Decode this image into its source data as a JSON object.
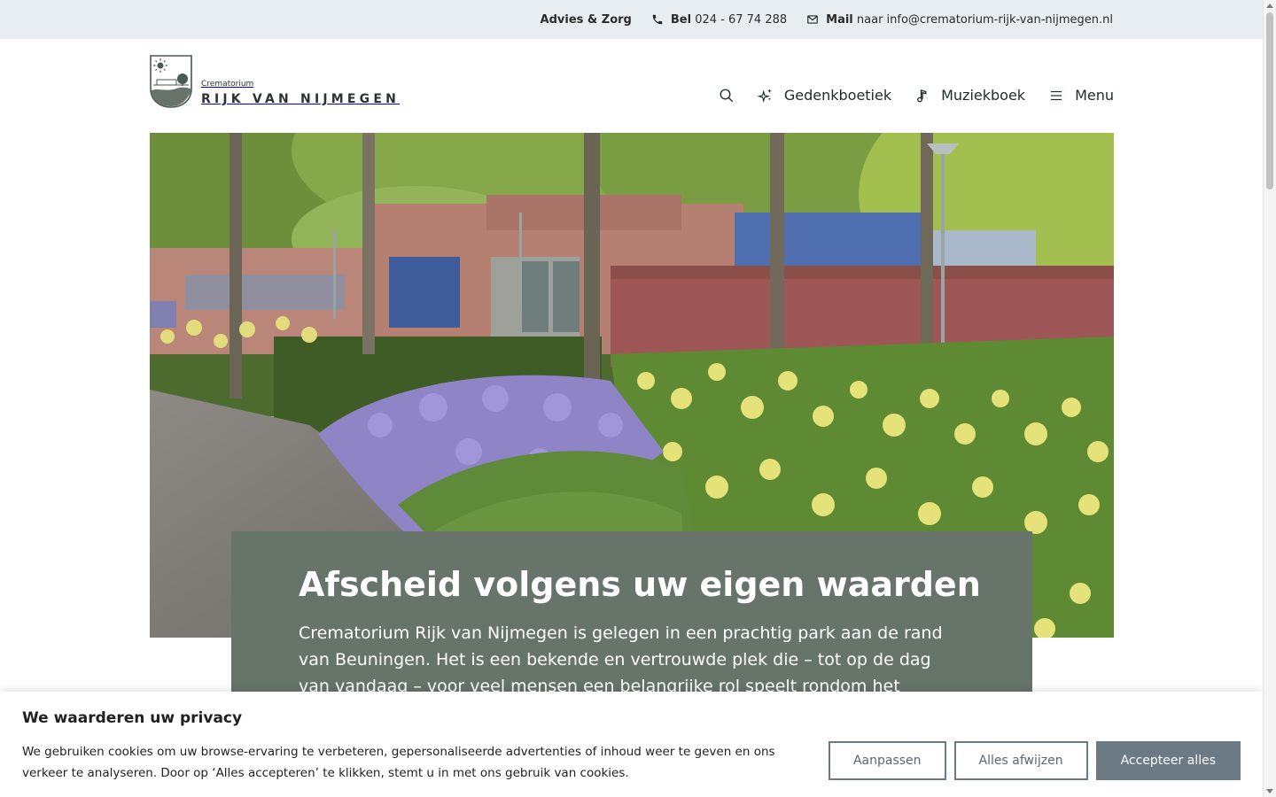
{
  "topbar": {
    "advice_label": "Advies & Zorg",
    "phone_label": "Bel",
    "phone_number": "024 - 67 74 288",
    "mail_label": "Mail",
    "mail_text": "naar info@crematorium-rijk-van-nijmegen.nl"
  },
  "logo": {
    "small": "Crematorium",
    "big": "RIJK VAN NIJMEGEN"
  },
  "nav": {
    "items": [
      {
        "label": "Gedenkboetiek",
        "icon": "sparkle-icon"
      },
      {
        "label": "Muziekboek",
        "icon": "music-note-icon"
      },
      {
        "label": "Menu",
        "icon": "hamburger-icon"
      }
    ]
  },
  "intro": {
    "title": "Afscheid volgens uw eigen waarden",
    "text": "Crematorium Rijk van Nijmegen is gelegen in een prachtig park aan de rand van Beuningen. Het is een bekende en vertrouwde plek die – tot op de dag van vandaag – voor veel mensen een belangrijke rol speelt rondom het afscheid, om"
  },
  "cookie": {
    "title": "We waarderen uw privacy",
    "text": "We gebruiken cookies om uw browse-ervaring te verbeteren, gepersonaliseerde advertenties of inhoud weer te geven en ons verkeer te analyseren. Door op ‘Alles accepteren’ te klikken, stemt u in met ons gebruik van cookies.",
    "buttons": {
      "customize": "Aanpassen",
      "reject": "Alles afwijzen",
      "accept": "Accepteer alles"
    }
  },
  "colors": {
    "topbar_bg": "#e8edf1",
    "intro_bg": "#66746a",
    "button_accent": "#6c7a85"
  }
}
